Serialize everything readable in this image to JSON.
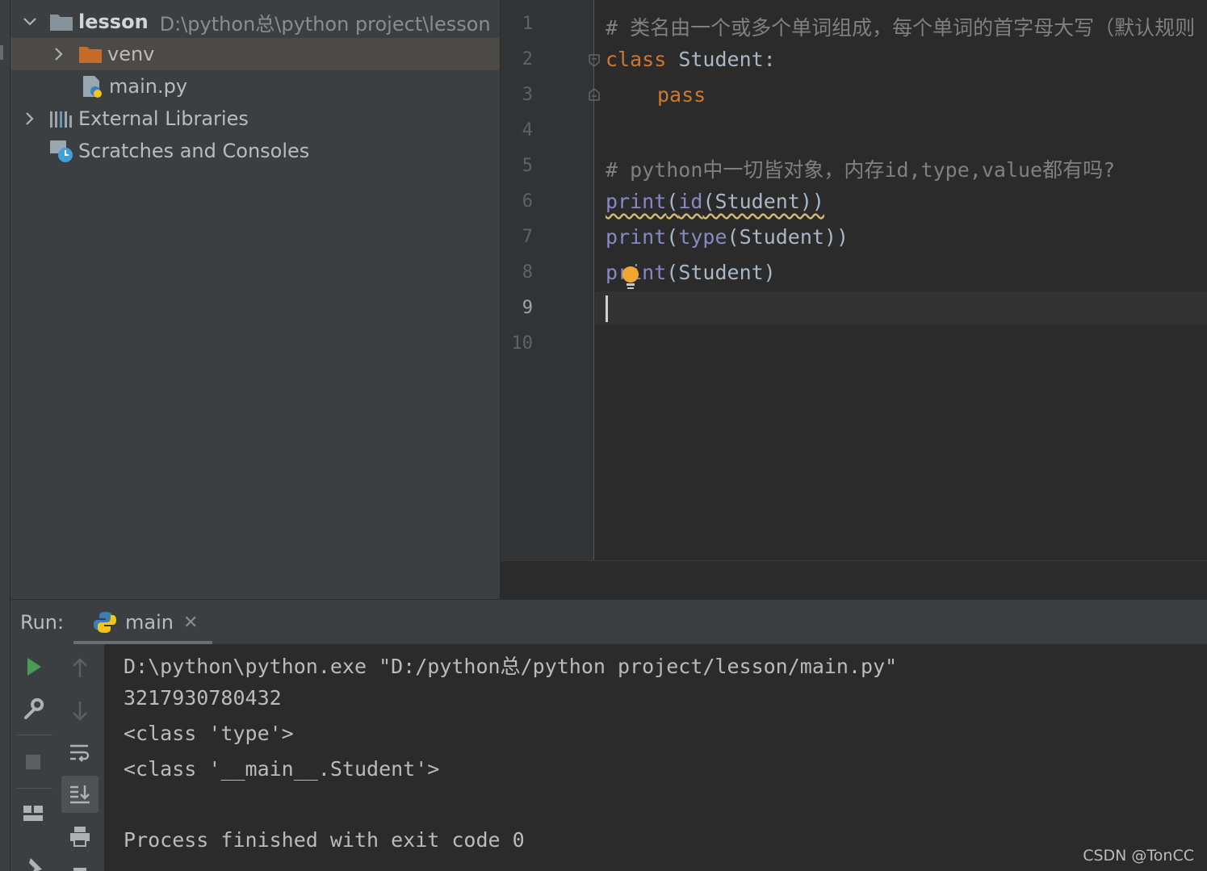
{
  "project": {
    "root": {
      "name": "lesson",
      "path": "D:\\python总\\python project\\lesson"
    },
    "items": [
      {
        "label": "venv",
        "type": "folder"
      },
      {
        "label": "main.py",
        "type": "python-file"
      },
      {
        "label": "External Libraries",
        "type": "libraries"
      },
      {
        "label": "Scratches and Consoles",
        "type": "scratches"
      }
    ]
  },
  "editor": {
    "line_numbers": [
      "1",
      "2",
      "3",
      "4",
      "5",
      "6",
      "7",
      "8",
      "9",
      "10"
    ],
    "current_line": "9",
    "lines": {
      "l1": "# 类名由一个或多个单词组成，每个单词的首字母大写（默认规则",
      "l2_kw": "class",
      "l2_rest": " Student:",
      "l3_kw": "pass",
      "l5": "# python中一切皆对象，内存id,type,value都有吗?",
      "l6_print": "print",
      "l6_p1": "(",
      "l6_id": "id",
      "l6_rest": "(Student))",
      "l7_print": "print",
      "l7_p1": "(",
      "l7_type": "type",
      "l7_rest": "(Student))",
      "l8_print": "print",
      "l8_rest": "(Student)"
    }
  },
  "run": {
    "title": "Run:",
    "tab_label": "main",
    "output": [
      "D:\\python\\python.exe \"D:/python总/python project/lesson/main.py\"",
      "3217930780432",
      "<class 'type'>",
      "<class '__main__.Student'>",
      "",
      "Process finished with exit code 0"
    ]
  },
  "watermark": "CSDN @TonCC",
  "colors": {
    "keyword": "#cc7832",
    "builtin": "#8888c6",
    "comment": "#808080",
    "run_green": "#499c54"
  }
}
